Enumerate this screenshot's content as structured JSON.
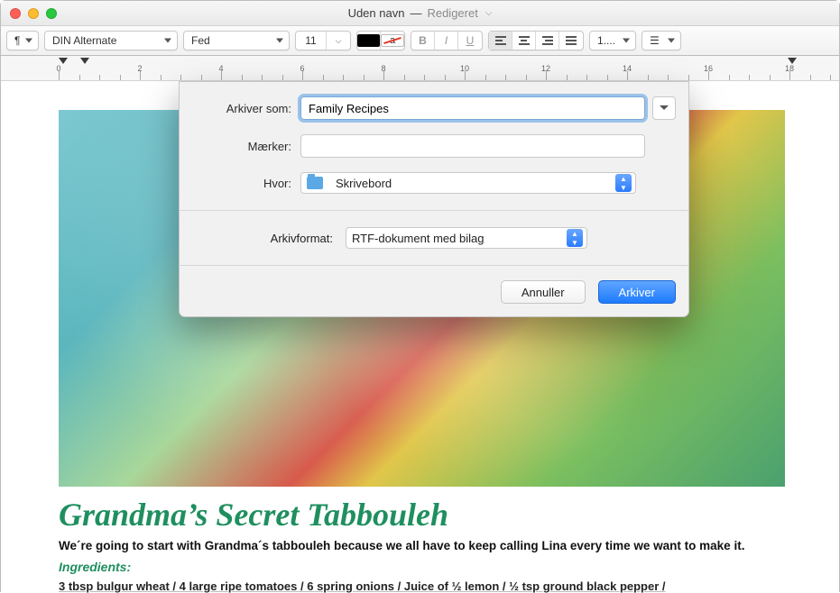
{
  "window": {
    "title": "Uden navn",
    "edited": "Redigeret"
  },
  "toolbar": {
    "para_symbol": "¶",
    "font_family": "DIN Alternate",
    "font_weight": "Fed",
    "font_size": "11",
    "bold": "B",
    "italic": "I",
    "underline": "U",
    "spacing": "1....",
    "list_marker": "•"
  },
  "ruler": {
    "numbers": [
      "0",
      "2",
      "4",
      "6",
      "8",
      "10",
      "12",
      "14",
      "16",
      "18"
    ]
  },
  "document": {
    "headline": "Grandma’s Secret Tabbouleh",
    "paragraph": "We´re going to start with Grandma´s tabbouleh because we all have to keep calling Lina every time we want to make it.",
    "ingredients_label": "Ingredients:",
    "ingredients_line": "3 tbsp bulgur wheat / 4 large ripe tomatoes / 6 spring onions / Juice of ½ lemon / ½ tsp ground black pepper /"
  },
  "save_sheet": {
    "save_as_label": "Arkiver som:",
    "save_as_value": "Family Recipes",
    "tags_label": "Mærker:",
    "tags_value": "",
    "where_label": "Hvor:",
    "where_value": "Skrivebord",
    "format_label": "Arkivformat:",
    "format_value": "RTF-dokument med bilag",
    "cancel": "Annuller",
    "confirm": "Arkiver"
  }
}
